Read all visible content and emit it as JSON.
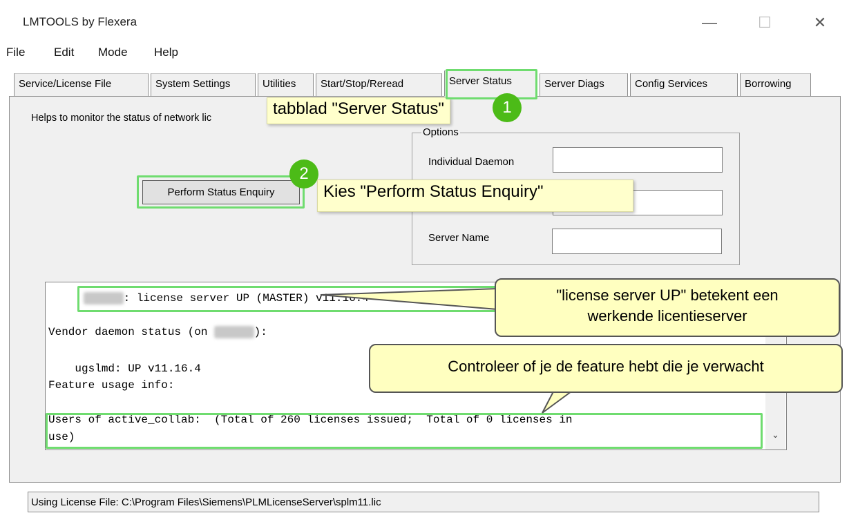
{
  "window": {
    "title": "LMTOOLS by Flexera",
    "minimize_glyph": "—",
    "maximize_glyph": "☐",
    "close_glyph": "✕"
  },
  "menu": [
    "File",
    "Edit",
    "Mode",
    "Help"
  ],
  "tabs": [
    {
      "label": "Service/License File"
    },
    {
      "label": "System Settings"
    },
    {
      "label": "Utilities"
    },
    {
      "label": "Start/Stop/Reread"
    },
    {
      "label": "Server Status"
    },
    {
      "label": "Server Diags"
    },
    {
      "label": "Config Services"
    },
    {
      "label": "Borrowing"
    }
  ],
  "panel": {
    "help_text": "Helps to monitor the status of network lic",
    "perform_button": "Perform Status Enquiry",
    "options": {
      "legend": "Options",
      "individual_daemon_label": "Individual Daemon",
      "individual_daemon_value": "",
      "middle_value": "",
      "server_name_label": "Server Name",
      "server_name_value": ""
    }
  },
  "output": {
    "line1": ": license server UP (MASTER) v11.16.4",
    "line2_prefix": "Vendor daemon status (on ",
    "line2_suffix": "):",
    "line3": "    ugslmd: UP v11.16.4",
    "line4": "Feature usage info:",
    "line5": "Users of active_collab:  (Total of 260 licenses issued;  Total of 0 licenses in",
    "line6": "use)"
  },
  "scroll_down_glyph": "⌄",
  "status": {
    "text": "Using License File:  C:\\Program Files\\Siemens\\PLMLicenseServer\\splm11.lic"
  },
  "annotations": {
    "callout1": "tabblad \"Server Status\"",
    "badge1": "1",
    "callout2": "Kies \"Perform Status Enquiry\"",
    "badge2": "2",
    "balloon1_line1": "\"license server UP\" betekent een",
    "balloon1_line2": "werkende licentieserver",
    "balloon2": "Controleer of je de feature hebt die je verwacht",
    "highlight_color": "#6fdc6f",
    "badge_color": "#4cbb17",
    "callout_color": "#ffffcc"
  }
}
